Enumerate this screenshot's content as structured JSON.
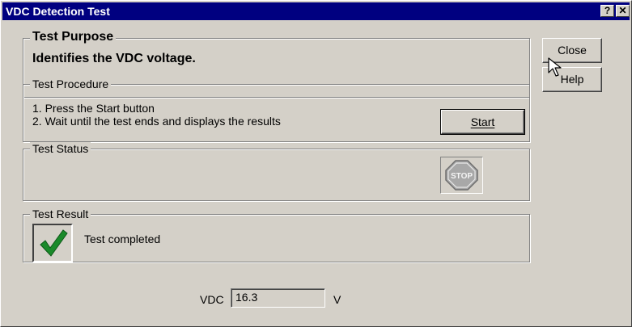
{
  "window": {
    "title": "VDC Detection Test",
    "help_glyph": "?",
    "close_glyph": "✕"
  },
  "purpose": {
    "legend": "Test Purpose",
    "text": "Identifies the VDC voltage."
  },
  "procedure": {
    "legend": "Test Procedure",
    "steps": [
      "1. Press the Start button",
      "2. Wait until the test ends and displays the results"
    ],
    "start_label": "Start"
  },
  "status": {
    "legend": "Test Status",
    "stop_sign_text": "STOP",
    "stop_icon": "stop-sign-icon"
  },
  "result": {
    "legend": "Test Result",
    "message": "Test completed",
    "icon": "checkmark-icon"
  },
  "side_buttons": {
    "close_label": "Close",
    "help_label": "Help"
  },
  "vdc": {
    "label": "VDC",
    "value": "16.3",
    "unit": "V"
  },
  "colors": {
    "titlebar": "#000080",
    "face": "#d4d0c8",
    "check": "#1a8a2a",
    "stop": "#a8a8a8"
  }
}
